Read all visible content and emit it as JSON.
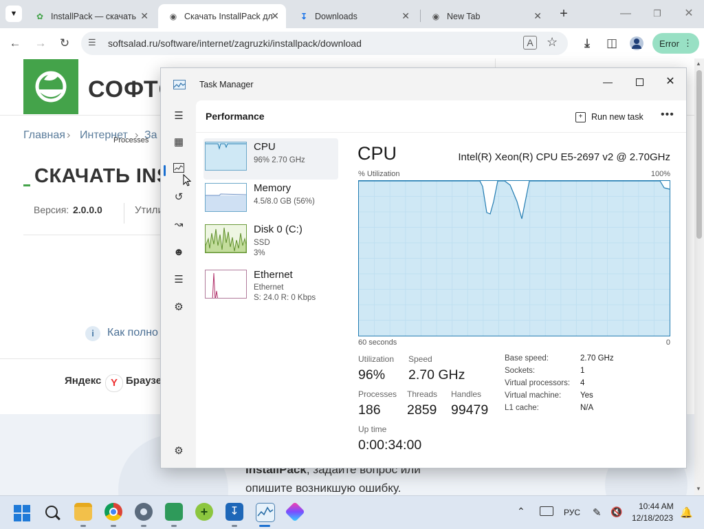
{
  "browser": {
    "tabs": [
      {
        "title": "InstallPack — скачать",
        "icon": "softsalad-favicon"
      },
      {
        "title": "Скачать InstallPack дл",
        "icon": "chrome-icon"
      },
      {
        "title": "Downloads",
        "icon": "download-icon"
      },
      {
        "title": "New Tab",
        "icon": "chrome-icon"
      }
    ],
    "url": "softsalad.ru/software/internet/zagruzki/installpack/download",
    "profile_button": "Error"
  },
  "page": {
    "site_name": "СОФТС",
    "breadcrumbs": [
      "Главная",
      "Интернет",
      "За"
    ],
    "tooltip": "Processes",
    "heading": "СКАЧАТЬ INST",
    "version_label": "Версия:",
    "version_value": "2.0.0.0",
    "util_text": "Утили",
    "info_text": "Как полно",
    "yandex_label": "Яндекс",
    "yandex_browser": "Браузе",
    "footer_text_1": "InstallPack, задайте вопрос или",
    "footer_text_bold": "InstallPack",
    "footer_text_rest": ", задайте вопрос или",
    "footer_text_2": "опишите возникшую ошибку."
  },
  "taskmgr": {
    "title": "Task Manager",
    "header_title": "Performance",
    "run_new_task": "Run new task",
    "side": [
      {
        "name": "CPU",
        "sub1": "96%  2.70 GHz",
        "sub2": ""
      },
      {
        "name": "Memory",
        "sub1": "4.5/8.0 GB (56%)",
        "sub2": ""
      },
      {
        "name": "Disk 0 (C:)",
        "sub1": "SSD",
        "sub2": "3%"
      },
      {
        "name": "Ethernet",
        "sub1": "Ethernet",
        "sub2": "S: 24.0  R: 0 Kbps"
      }
    ],
    "cpu": {
      "title": "CPU",
      "model": "Intel(R) Xeon(R) CPU E5-2697 v2 @ 2.70GHz",
      "util_label": "% Utilization",
      "max_label": "100%",
      "time_label": "60 seconds",
      "zero_label": "0",
      "utilization_label": "Utilization",
      "utilization": "96%",
      "speed_label": "Speed",
      "speed": "2.70 GHz",
      "processes_label": "Processes",
      "processes": "186",
      "threads_label": "Threads",
      "threads": "2859",
      "handles_label": "Handles",
      "handles": "99479",
      "uptime_label": "Up time",
      "uptime": "0:00:34:00",
      "details": [
        {
          "label": "Base speed:",
          "value": "2.70 GHz"
        },
        {
          "label": "Sockets:",
          "value": "1"
        },
        {
          "label": "Virtual processors:",
          "value": "4"
        },
        {
          "label": "Virtual machine:",
          "value": "Yes"
        },
        {
          "label": "L1 cache:",
          "value": "N/A"
        }
      ],
      "graph_fill": "#cfe8f5",
      "graph_line": "#1f7ab0"
    }
  },
  "taskbar": {
    "lang": "РУС",
    "time": "10:44 AM",
    "date": "12/18/2023"
  }
}
